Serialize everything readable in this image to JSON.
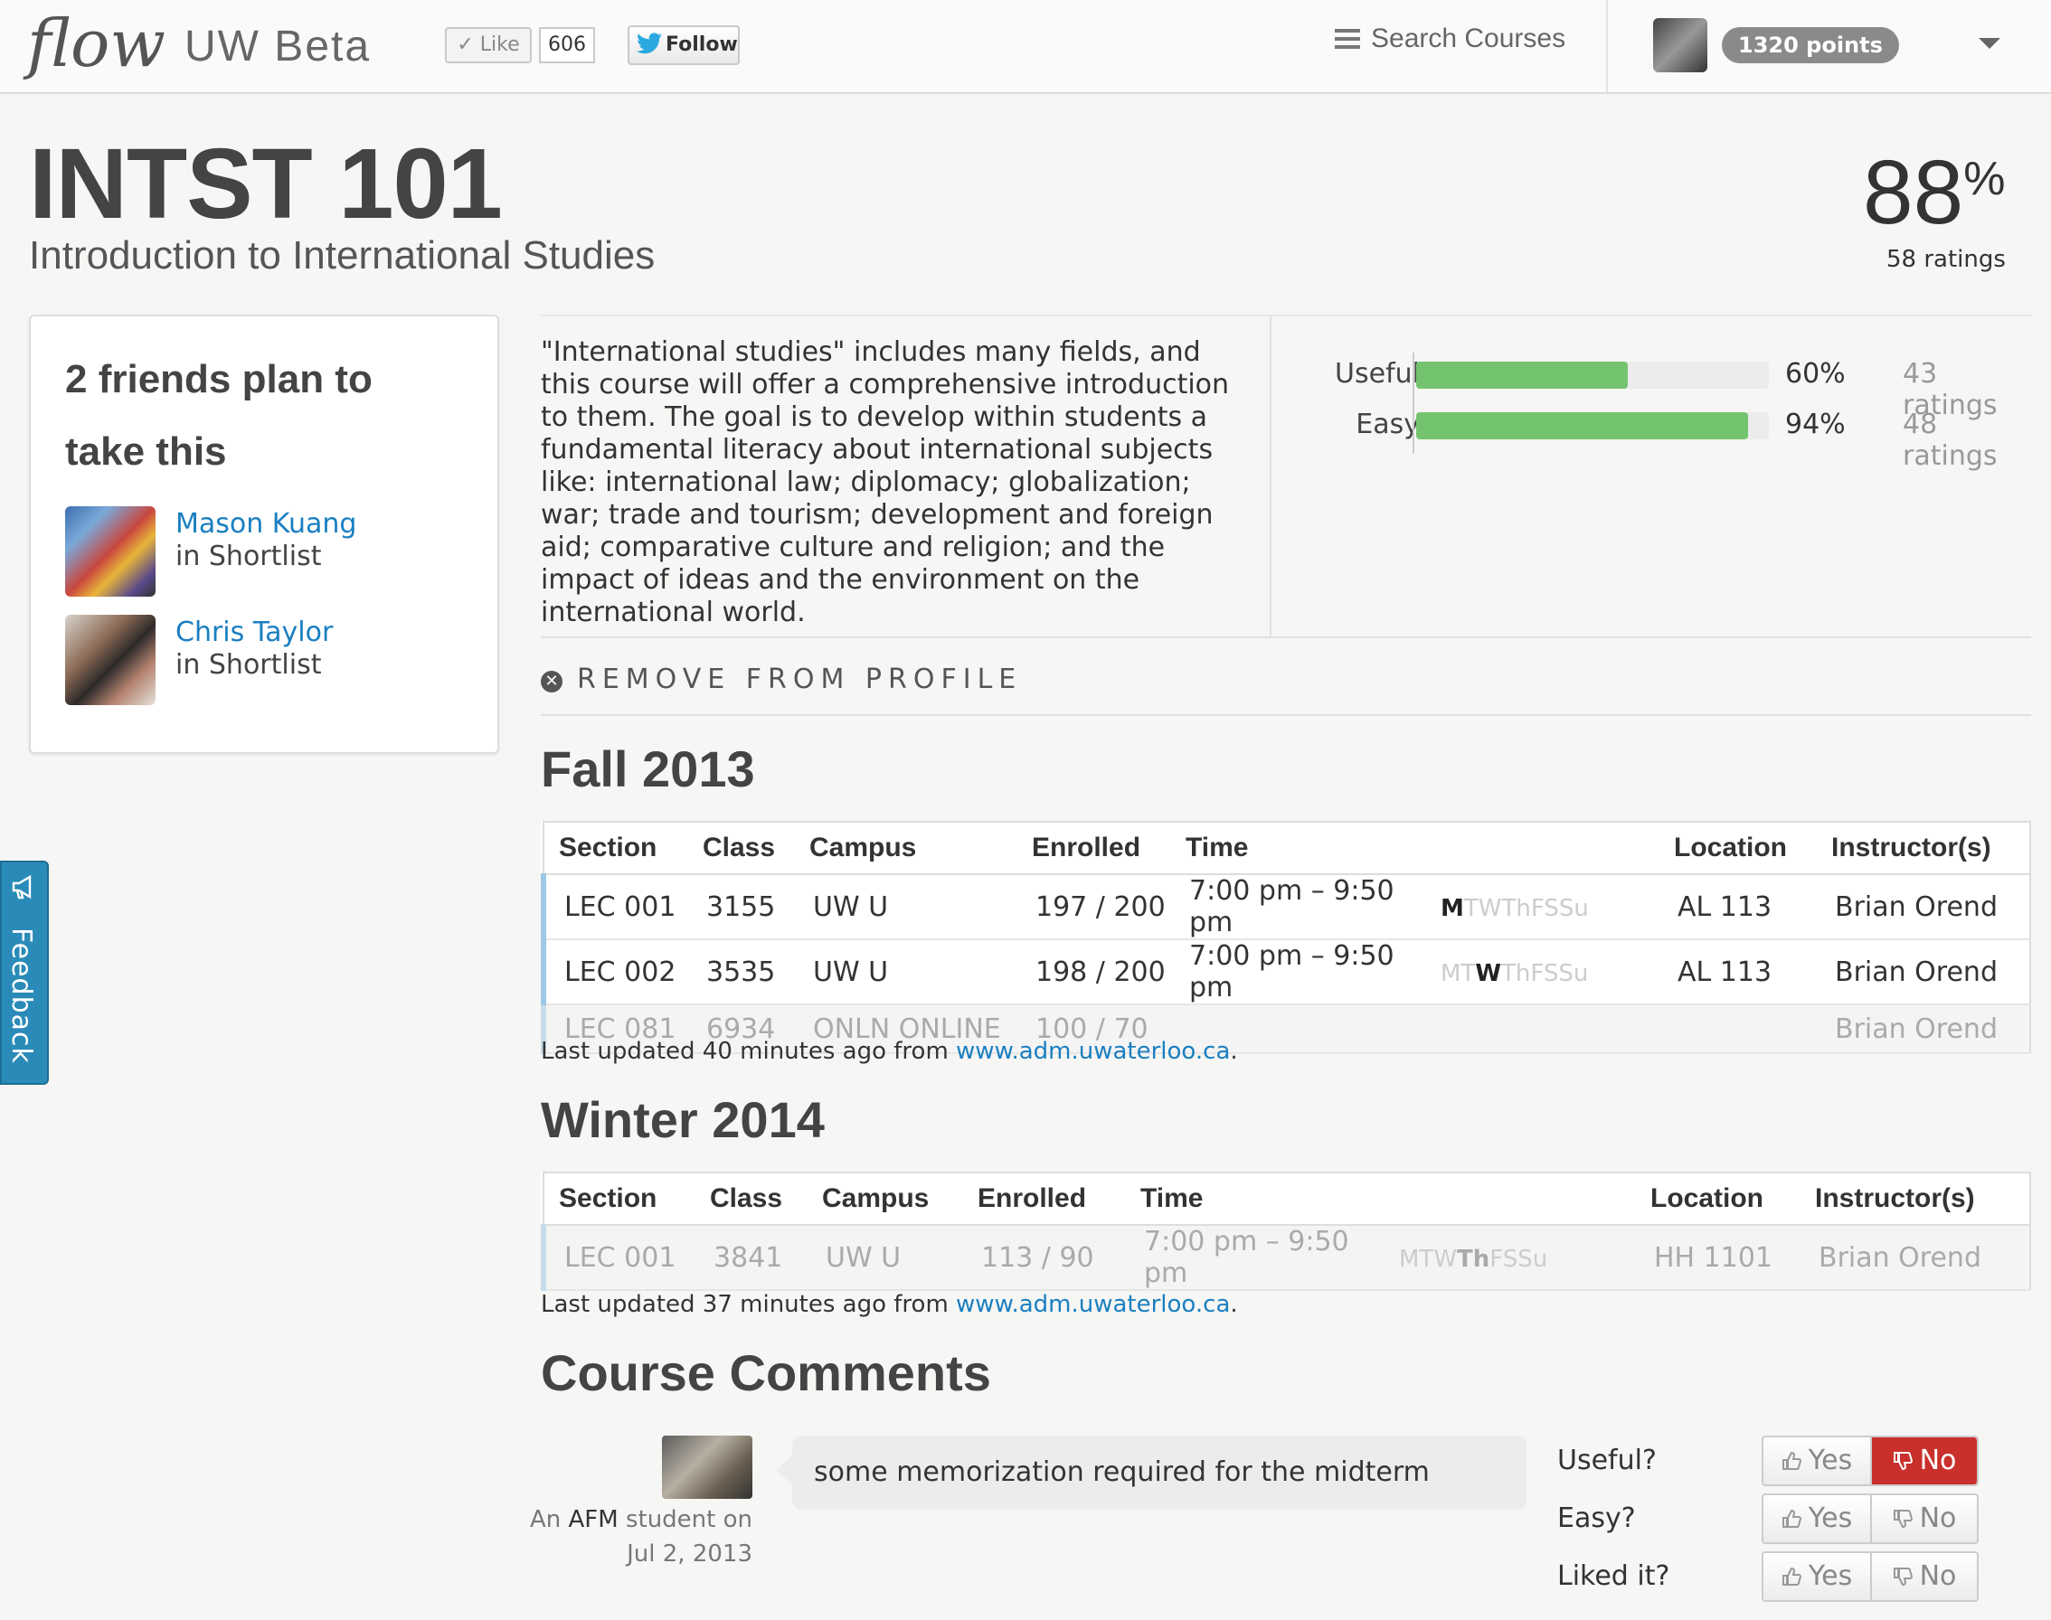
{
  "topbar": {
    "logo": "flow",
    "logo_sub": "UW Beta",
    "like_label": "Like",
    "like_count": "606",
    "follow_label": "Follow",
    "search_label": "Search Courses",
    "points_label": "1320 points"
  },
  "course": {
    "code": "INTST 101",
    "name": "Introduction to International Studies",
    "overall_percent": "88",
    "overall_percent_sign": "%",
    "overall_ratings": "58 ratings",
    "description": "\"International studies\" includes many fields, and this course will offer a comprehensive introduction to them. The goal is to develop within students a fundamental literacy about international subjects like: international law; diplomacy; globalization; war; trade and tourism; development and foreign aid; comparative culture and religion; and the impact of ideas and the environment on the international world."
  },
  "ratings": [
    {
      "label": "Useful",
      "percent_text": "60%",
      "value": 0.6,
      "count": "43 ratings"
    },
    {
      "label": "Easy",
      "percent_text": "94%",
      "value": 0.94,
      "count": "48 ratings"
    }
  ],
  "friends": {
    "title": "2 friends plan to take this",
    "list": [
      {
        "name": "Mason Kuang",
        "status": "in Shortlist"
      },
      {
        "name": "Chris Taylor",
        "status": "in Shortlist"
      }
    ]
  },
  "remove_label": "REMOVE FROM PROFILE",
  "terms": [
    {
      "title": "Fall 2013",
      "headers": [
        "Section",
        "Class",
        "Campus",
        "Enrolled",
        "Time",
        "Location",
        "Instructor(s)"
      ],
      "rows": [
        {
          "section": "LEC 001",
          "class": "3155",
          "campus": "UW U",
          "enrolled": "197 / 200",
          "time": "7:00 pm – 9:50 pm",
          "days_pre": "",
          "days_bold": "M",
          "days_post": "TWThFSSu",
          "location": "AL 113",
          "instructor": "Brian Orend"
        },
        {
          "section": "LEC 002",
          "class": "3535",
          "campus": "UW U",
          "enrolled": "198 / 200",
          "time": "7:00 pm – 9:50 pm",
          "days_pre": "MT",
          "days_bold": "W",
          "days_post": "ThFSSu",
          "location": "AL 113",
          "instructor": "Brian Orend"
        },
        {
          "section": "LEC 081",
          "class": "6934",
          "campus": "ONLN ONLINE",
          "enrolled": "100 / 70",
          "time": "",
          "days_pre": "",
          "days_bold": "",
          "days_post": "",
          "location": "",
          "instructor": "Brian Orend"
        }
      ],
      "updated_text": "Last updated 40 minutes ago from ",
      "updated_link": "www.adm.uwaterloo.ca",
      "updated_end": "."
    },
    {
      "title": "Winter 2014",
      "headers": [
        "Section",
        "Class",
        "Campus",
        "Enrolled",
        "Time",
        "Location",
        "Instructor(s)"
      ],
      "rows": [
        {
          "section": "LEC 001",
          "class": "3841",
          "campus": "UW U",
          "enrolled": "113 / 90",
          "time": "7:00 pm – 9:50 pm",
          "days_pre": "MTW",
          "days_bold": "Th",
          "days_post": "FSSu",
          "location": "HH 1101",
          "instructor": "Brian Orend"
        }
      ],
      "updated_text": "Last updated 37 minutes ago from ",
      "updated_link": "www.adm.uwaterloo.ca",
      "updated_end": "."
    }
  ],
  "comments": {
    "title": "Course Comments",
    "items": [
      {
        "text": "some memorization required for the midterm",
        "meta_prefix": "An ",
        "program": "AFM",
        "meta_suffix": " student on",
        "date": "Jul 2, 2013",
        "questions": [
          {
            "label": "Useful?",
            "yes": "Yes",
            "no": "No",
            "selected": "no"
          },
          {
            "label": "Easy?",
            "yes": "Yes",
            "no": "No",
            "selected": ""
          },
          {
            "label": "Liked it?",
            "yes": "Yes",
            "no": "No",
            "selected": ""
          }
        ]
      }
    ]
  },
  "feedback_label": "Feedback",
  "colors": {
    "accent_link": "#1a7fc1",
    "rating_fill": "#74c46f",
    "no_active": "#c9302c",
    "feedback_tab": "#2a8bb8"
  },
  "icons": [
    "menu-icon",
    "like-check-icon",
    "twitter-bird-icon",
    "user-avatar",
    "dropdown-caret-icon",
    "remove-x-icon",
    "thumbs-up-icon",
    "thumbs-down-icon",
    "megaphone-icon"
  ]
}
